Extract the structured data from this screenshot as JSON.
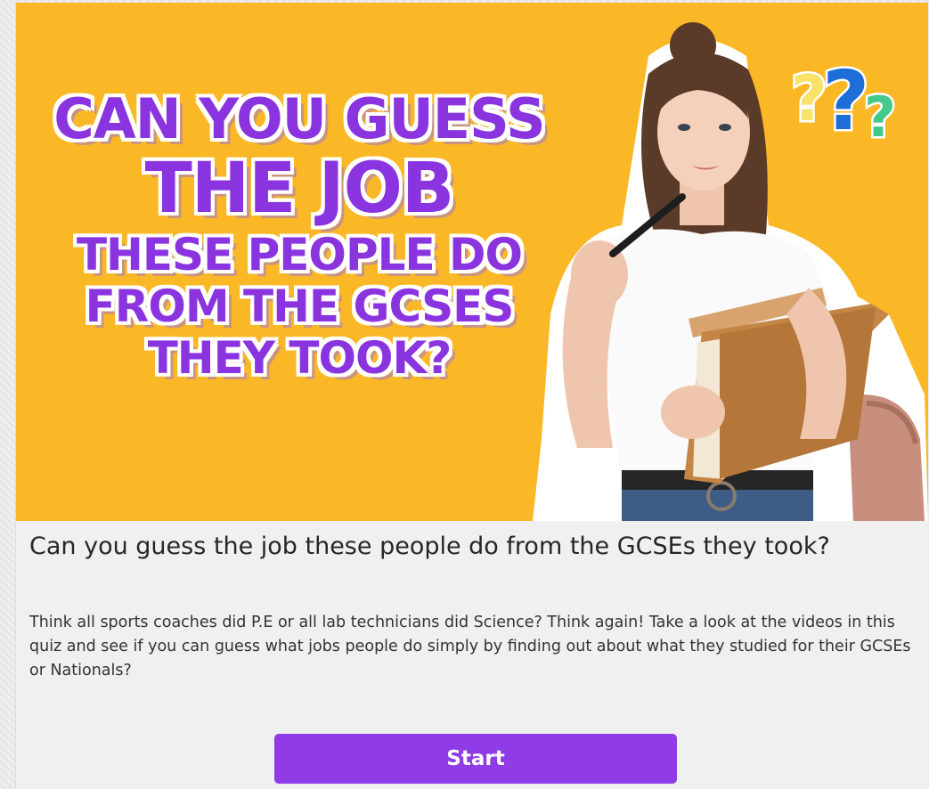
{
  "hero": {
    "headline_line1": "CAN YOU GUESS",
    "headline_line2": "THE JOB",
    "headline_line3": "THESE PEOPLE DO",
    "headline_line4": "FROM THE GCSES",
    "headline_line5": "THEY TOOK?",
    "background_color": "#fbb826",
    "headline_color": "#8a34e0",
    "decoration_icon": "question-marks-icon",
    "photo_subject": "student-holding-books-image"
  },
  "quiz": {
    "title": "Can you guess the job these people do from the GCSEs they took?",
    "description": "Think all sports coaches did P.E or all lab technicians did Science? Think again! Take a look at the videos in this quiz and see if you can guess what jobs people do simply by finding out about what they studied for their GCSEs or Nationals?",
    "start_label": "Start",
    "accent_color": "#8f3be6"
  }
}
